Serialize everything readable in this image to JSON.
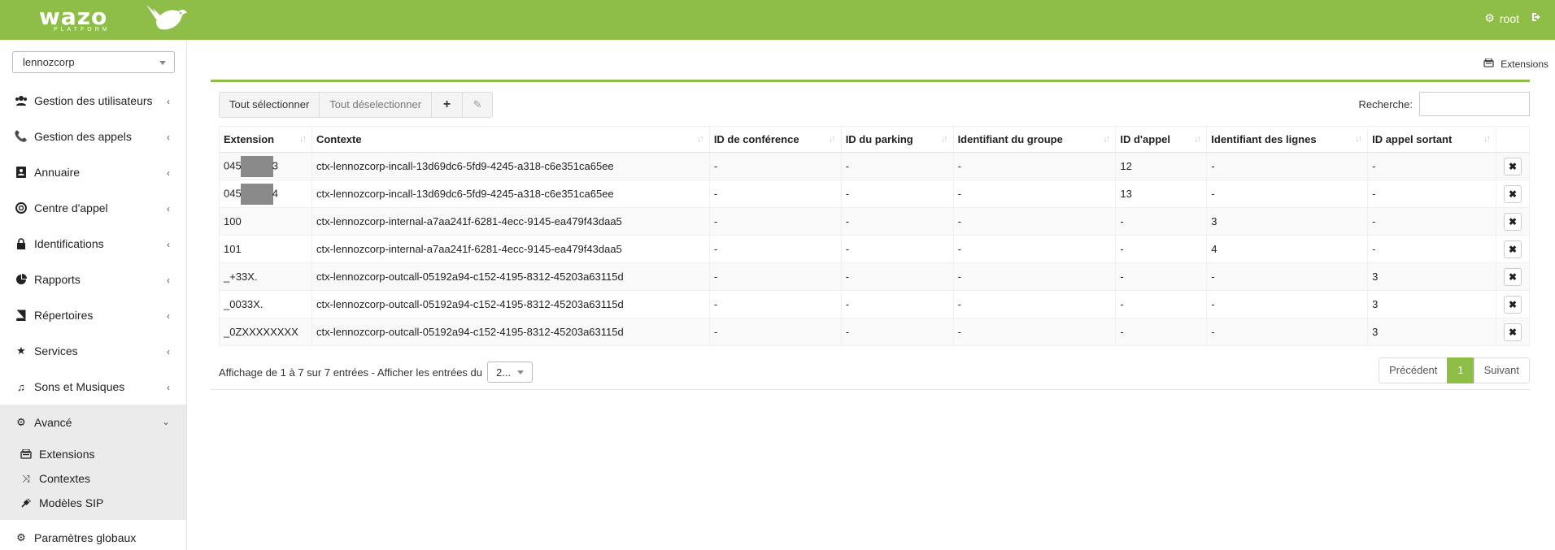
{
  "header": {
    "logo_word": "wazo",
    "logo_sub": "PLATFORM",
    "user_label": "root",
    "brand_color": "#8ebe47"
  },
  "sidebar": {
    "tenant": "lennozcorp",
    "items": [
      {
        "label": "Gestion des utilisateurs",
        "icon": "users-icon"
      },
      {
        "label": "Gestion des appels",
        "icon": "phone-icon"
      },
      {
        "label": "Annuaire",
        "icon": "address-book-icon"
      },
      {
        "label": "Centre d'appel",
        "icon": "lifebuoy-icon"
      },
      {
        "label": "Identifications",
        "icon": "lock-icon"
      },
      {
        "label": "Rapports",
        "icon": "pie-chart-icon"
      },
      {
        "label": "Répertoires",
        "icon": "book-icon"
      },
      {
        "label": "Services",
        "icon": "star-icon"
      },
      {
        "label": "Sons et Musiques",
        "icon": "music-icon"
      },
      {
        "label": "Avancé",
        "icon": "cogs-icon"
      }
    ],
    "subitems": [
      {
        "label": "Extensions",
        "icon": "fax-icon"
      },
      {
        "label": "Contextes",
        "icon": "shuffle-icon"
      },
      {
        "label": "Modèles SIP",
        "icon": "plug-icon"
      }
    ],
    "last_item": {
      "label": "Paramètres globaux",
      "icon": "cogs-icon"
    }
  },
  "breadcrumb": {
    "label": "Extensions"
  },
  "toolbar": {
    "select_all": "Tout sélectionner",
    "deselect_all": "Tout déselectionner"
  },
  "search": {
    "label": "Recherche:",
    "value": ""
  },
  "table": {
    "columns": [
      "Extension",
      "Contexte",
      "ID de conférence",
      "ID du parking",
      "Identifiant du groupe",
      "ID d'appel",
      "Identifiant des lignes",
      "ID appel sortant"
    ],
    "rows": [
      {
        "ext_pre": "045",
        "ext_post": "3",
        "redacted": true,
        "context": "ctx-lennozcorp-incall-13d69dc6-5fd9-4245-a318-c6e351ca65ee",
        "conf": "-",
        "parking": "-",
        "group": "-",
        "incall": "12",
        "line": "-",
        "outcall": "-"
      },
      {
        "ext_pre": "045",
        "ext_post": "4",
        "redacted": true,
        "context": "ctx-lennozcorp-incall-13d69dc6-5fd9-4245-a318-c6e351ca65ee",
        "conf": "-",
        "parking": "-",
        "group": "-",
        "incall": "13",
        "line": "-",
        "outcall": "-"
      },
      {
        "ext_pre": "100",
        "ext_post": "",
        "redacted": false,
        "context": "ctx-lennozcorp-internal-a7aa241f-6281-4ecc-9145-ea479f43daa5",
        "conf": "-",
        "parking": "-",
        "group": "-",
        "incall": "-",
        "line": "3",
        "outcall": "-"
      },
      {
        "ext_pre": "101",
        "ext_post": "",
        "redacted": false,
        "context": "ctx-lennozcorp-internal-a7aa241f-6281-4ecc-9145-ea479f43daa5",
        "conf": "-",
        "parking": "-",
        "group": "-",
        "incall": "-",
        "line": "4",
        "outcall": "-"
      },
      {
        "ext_pre": "_+33X.",
        "ext_post": "",
        "redacted": false,
        "context": "ctx-lennozcorp-outcall-05192a94-c152-4195-8312-45203a63115d",
        "conf": "-",
        "parking": "-",
        "group": "-",
        "incall": "-",
        "line": "-",
        "outcall": "3"
      },
      {
        "ext_pre": "_0033X.",
        "ext_post": "",
        "redacted": false,
        "context": "ctx-lennozcorp-outcall-05192a94-c152-4195-8312-45203a63115d",
        "conf": "-",
        "parking": "-",
        "group": "-",
        "incall": "-",
        "line": "-",
        "outcall": "3"
      },
      {
        "ext_pre": "_0ZXXXXXXXX",
        "ext_post": "",
        "redacted": false,
        "context": "ctx-lennozcorp-outcall-05192a94-c152-4195-8312-45203a63115d",
        "conf": "-",
        "parking": "-",
        "group": "-",
        "incall": "-",
        "line": "-",
        "outcall": "3"
      }
    ]
  },
  "footer": {
    "info": "Affichage de 1 à 7 sur 7 entrées -  Afficher les entrées du",
    "page_length": "2...",
    "prev": "Précédent",
    "page": "1",
    "next": "Suivant"
  }
}
